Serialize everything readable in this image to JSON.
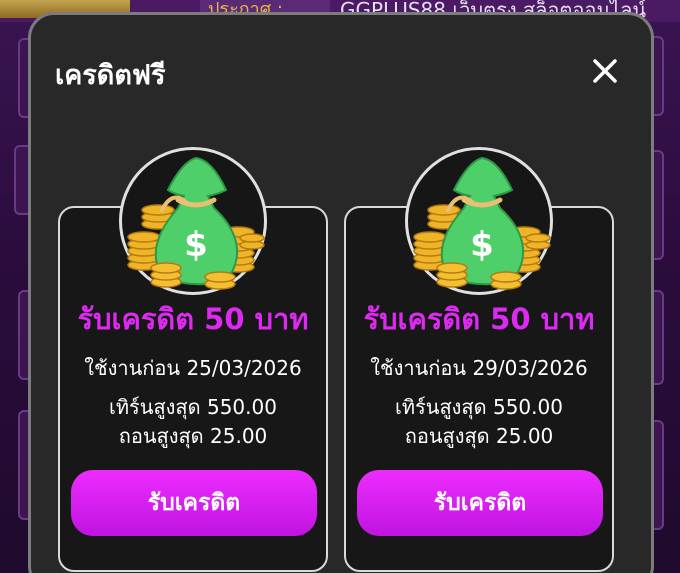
{
  "background": {
    "marquee_text": "GGPLUS88 เว็บตรง สล็อตออนไลน์",
    "announce_label": "ประกาศ :"
  },
  "modal": {
    "title": "เครดิตฟรี",
    "close_icon": "close-icon"
  },
  "cards": [
    {
      "title": "รับเครดิต 50 บาท",
      "expiry": "ใช้งานก่อน 25/03/2026",
      "turnover": "เทิร์นสูงสุด 550.00",
      "withdraw": "ถอนสูงสุด 25.00",
      "button_label": "รับเครดิต",
      "icon": "money-bag-icon"
    },
    {
      "title": "รับเครดิต 50 บาท",
      "expiry": "ใช้งานก่อน 29/03/2026",
      "turnover": "เทิร์นสูงสุด 550.00",
      "withdraw": "ถอนสูงสุด 25.00",
      "button_label": "รับเครดิต",
      "icon": "money-bag-icon"
    }
  ],
  "colors": {
    "accent": "#e020f5",
    "modal_bg": "#282828",
    "card_bg": "#171717"
  }
}
